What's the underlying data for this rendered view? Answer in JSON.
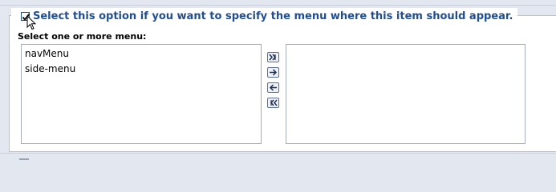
{
  "menu_section": {
    "checkbox_checked": true,
    "option_label": "Select this option if you want to specify the menu where this item should appear.",
    "select_label": "Select one or more menu:",
    "available_menus": [
      "navMenu",
      "side-menu"
    ],
    "selected_menus": []
  },
  "transfer_buttons": [
    {
      "name": "move-all-right-button",
      "icon": "double-arrow-right-icon"
    },
    {
      "name": "move-right-button",
      "icon": "arrow-right-icon"
    },
    {
      "name": "move-left-button",
      "icon": "arrow-left-icon"
    },
    {
      "name": "move-all-left-button",
      "icon": "double-arrow-left-icon"
    }
  ],
  "colors": {
    "label_blue": "#1f4e92",
    "page_bg": "#e3e7ef"
  }
}
